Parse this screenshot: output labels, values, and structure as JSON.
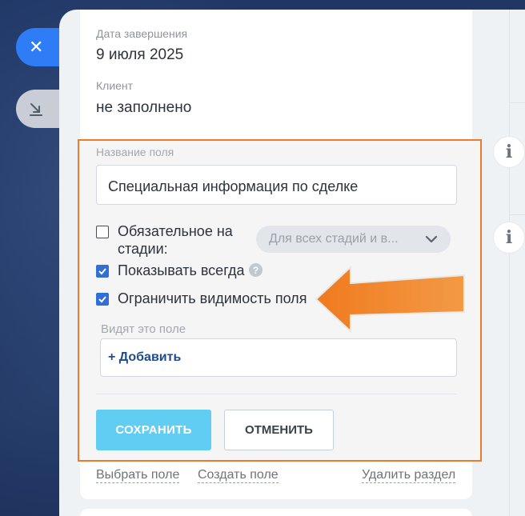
{
  "sidebar": {
    "close_icon": "close-icon",
    "collapse_icon": "collapse-down-icon"
  },
  "details": {
    "end_date_label": "Дата завершения",
    "end_date_value": "9 июля 2025",
    "client_label": "Клиент",
    "client_value": "не заполнено"
  },
  "editor": {
    "field_name_label": "Название поля",
    "field_name_value": "Специальная информация по сделке",
    "required_label_line1": "Обязательное на",
    "required_label_line2": "стадии:",
    "required_checked": false,
    "stage_select_value": "Для всех стадий и в...",
    "show_always_label": "Показывать всегда",
    "show_always_checked": true,
    "restrict_visibility_label": "Ограничить видимость поля",
    "restrict_visibility_checked": true,
    "who_sees_label": "Видят это поле",
    "add_link": "+ Добавить",
    "save_button": "СОХРАНИТЬ",
    "cancel_button": "ОТМЕНИТЬ"
  },
  "footer": {
    "choose_field": "Выбрать поле",
    "create_field": "Создать поле",
    "delete_section": "Удалить раздел"
  },
  "colors": {
    "accent": "#2f7df6",
    "save_button": "#62cdf2",
    "highlight_border": "#ee7a2c",
    "arrow": "#f08a2c"
  }
}
